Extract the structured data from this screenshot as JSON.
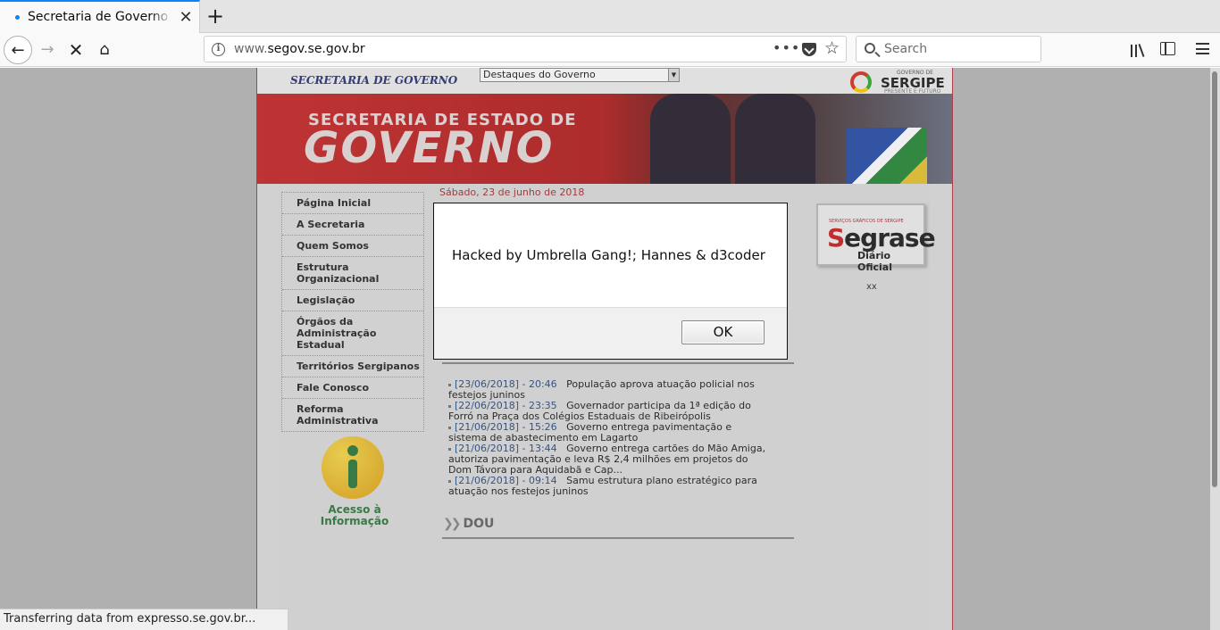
{
  "browser": {
    "tab": {
      "title": "Secretaria de Governo - Se"
    },
    "url": {
      "host_prefix": "www.",
      "domain": "segov.se.gov.br"
    },
    "search_placeholder": "Search",
    "accent_color": "#0a84ff",
    "status": "Transferring data from expresso.se.gov.br..."
  },
  "site": {
    "strip_title": "SECRETARIA DE GOVERNO",
    "select_value": "Destaques do Governo",
    "logo": {
      "small": "GOVERNO DE",
      "big": "SERGIPE",
      "sub": "PRESENTE E FUTURO"
    },
    "banner": {
      "subtitle": "SECRETARIA DE ESTADO DE",
      "title": "GOVERNO"
    },
    "date": "Sábado, 23 de junho de 2018",
    "menu": [
      "Página Inicial",
      "A Secretaria",
      "Quem Somos",
      "Estrutura Organizacional",
      "Legislação",
      "Órgãos da Administração Estadual",
      "Territórios Sergipanos",
      "Fale Conosco",
      "Reforma Administrativa"
    ],
    "news": [
      {
        "stamp": "[23/06/2018] - 20:46",
        "text": "População aprova atuação policial nos festejos juninos"
      },
      {
        "stamp": "[22/06/2018] - 23:35",
        "text": "Governador participa da 1ª edição do Forró na Praça dos Colégios Estaduais de Ribeirópolis"
      },
      {
        "stamp": "[21/06/2018] - 15:26",
        "text": "Governo entrega pavimentação e sistema de abastecimento em Lagarto"
      },
      {
        "stamp": "[21/06/2018] - 13:44",
        "text": "Governo entrega cartões do Mão Amiga, autoriza pavimentação e leva R$ 2,4 milhões em projetos do Dom Távora para Aquidabã e Cap..."
      },
      {
        "stamp": "[21/06/2018] - 09:14",
        "text": "Samu estrutura plano estratégico para atuação nos festejos juninos"
      }
    ],
    "dou_label": "DOU",
    "segrase": {
      "top": "SERVIÇOS GRÁFICOS DE SERGIPE",
      "name_first": "S",
      "name_rest": "egrase",
      "sub": "Diário Oficial"
    },
    "xx": "xx",
    "acesso": {
      "line1": "Acesso à",
      "line2": "Informação"
    }
  },
  "dialog": {
    "message": "Hacked by Umbrella Gang!; Hannes & d3coder",
    "ok_label": "OK"
  }
}
